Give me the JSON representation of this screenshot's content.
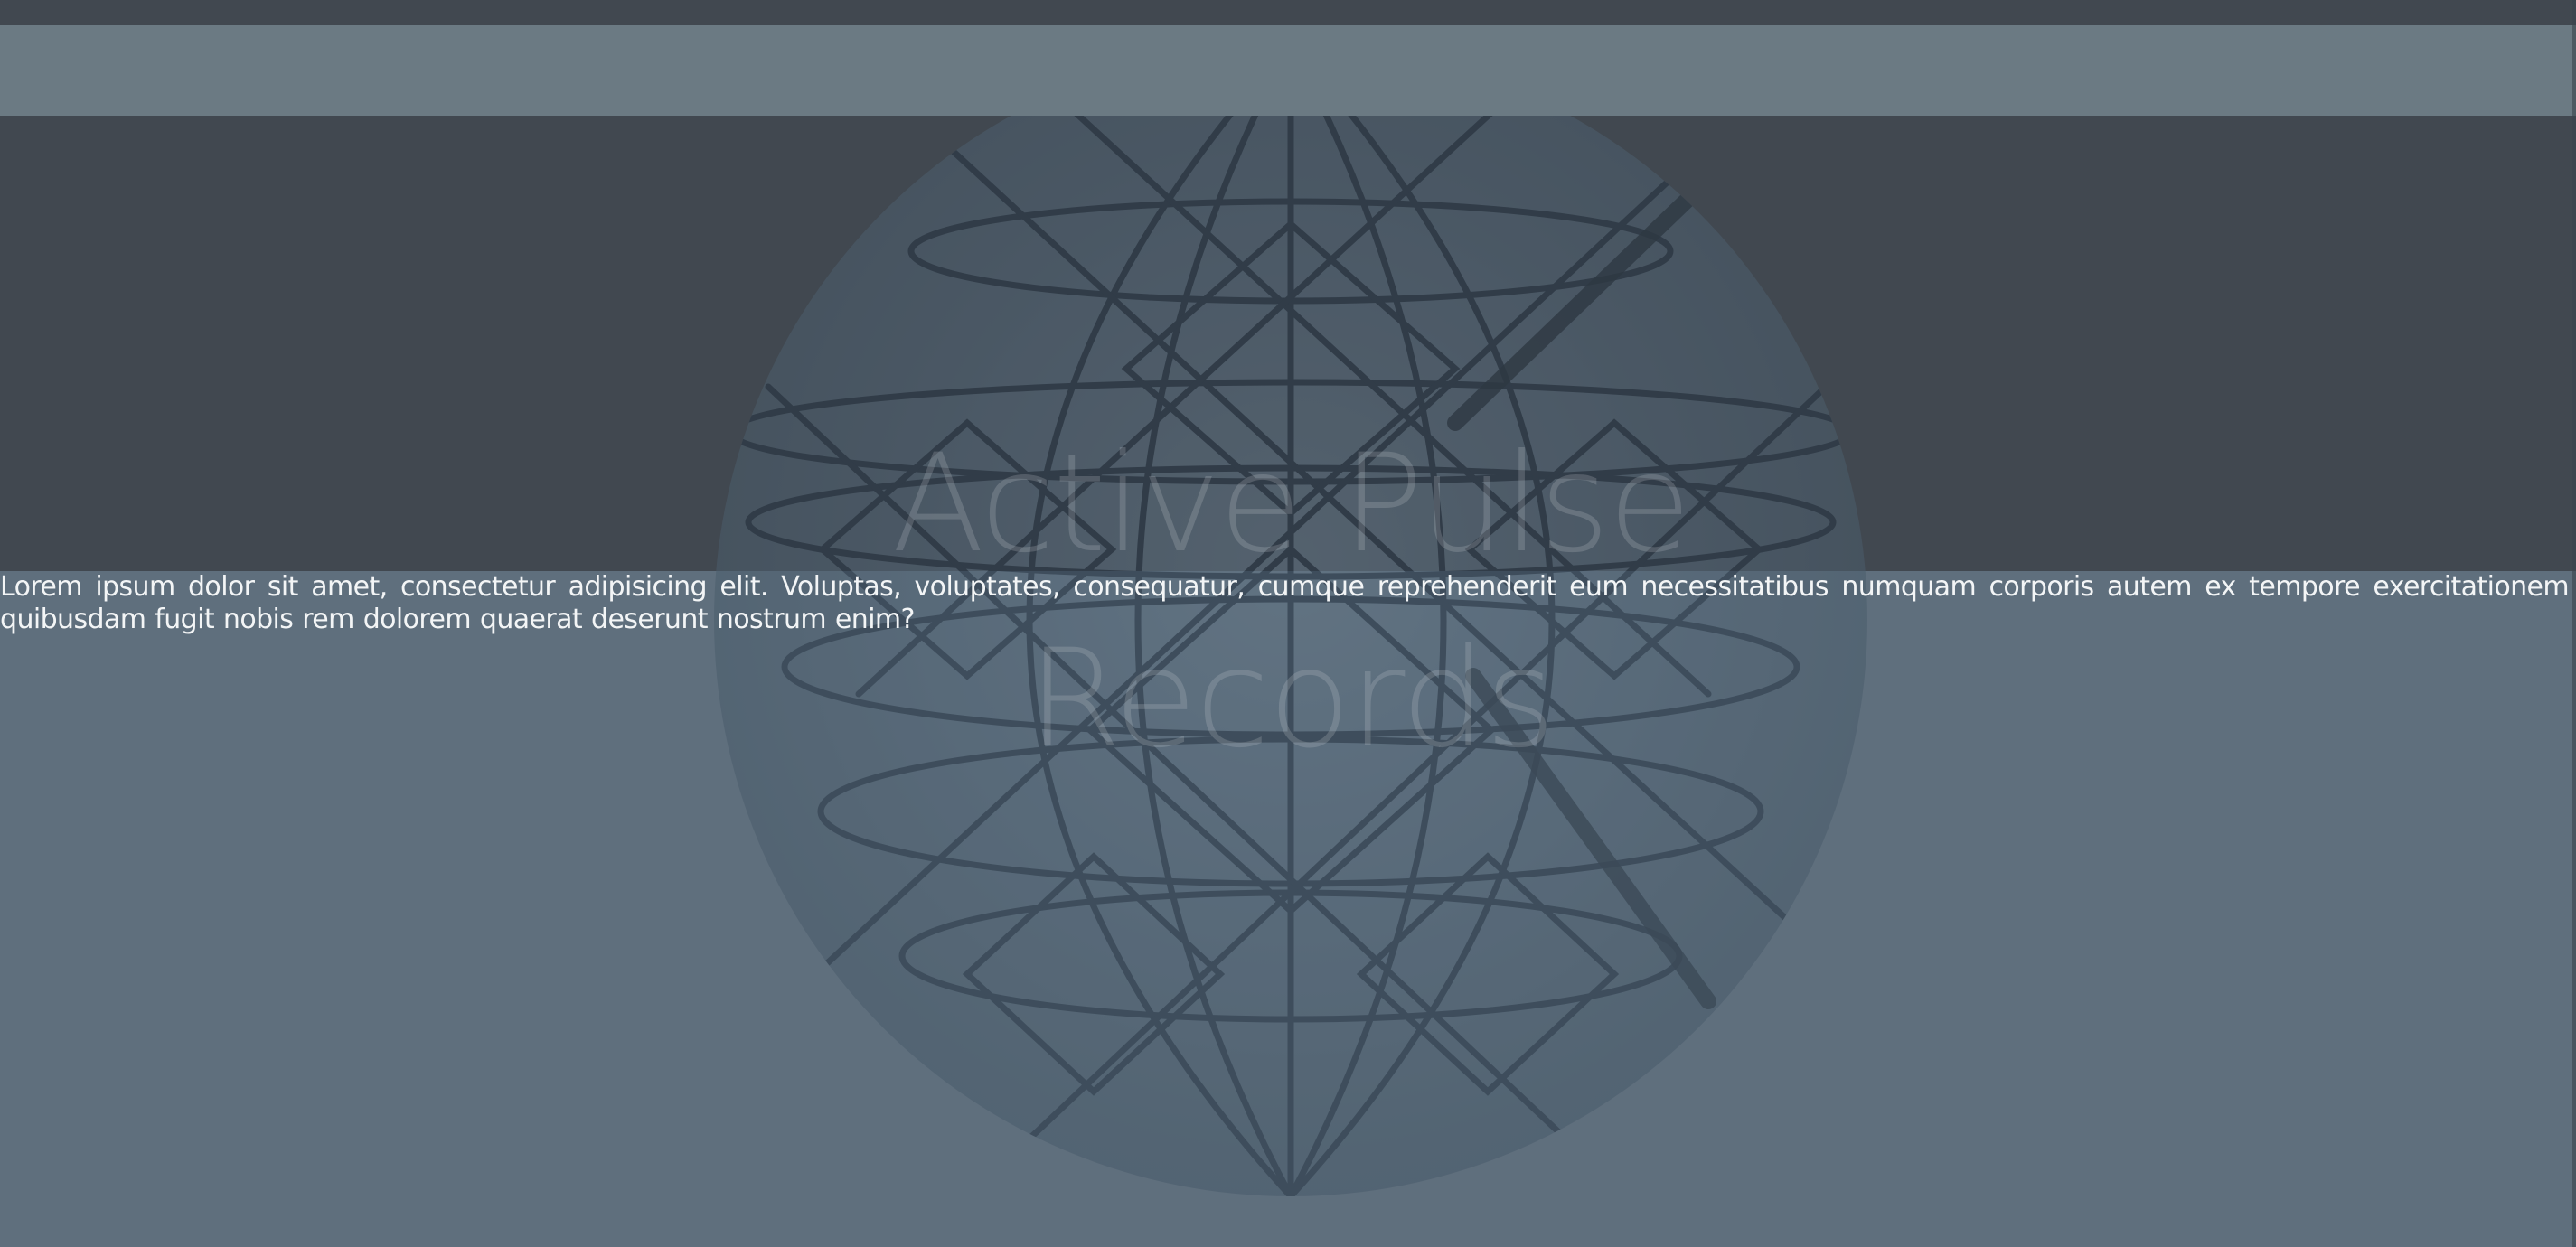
{
  "hero": {
    "title_line1": "Active Pulse",
    "title_line2": "Records"
  },
  "intro": {
    "text": "Lorem ipsum dolor sit amet, consectetur adipisicing elit. Voluptas, voluptates, consequatur, cumque reprehenderit eum necessitatibus numquam corporis autem ex tempore exercitationem quibusdam fugit nobis rem dolorem quaerat deserunt nostrum enim?"
  },
  "colors": {
    "header_dark": "#414850",
    "nav_band": "#6b7a83",
    "page_background": "#5f6f7d",
    "text": "#f3f5f6"
  },
  "icons": {
    "hero_image": "geodesic-globe-image"
  }
}
